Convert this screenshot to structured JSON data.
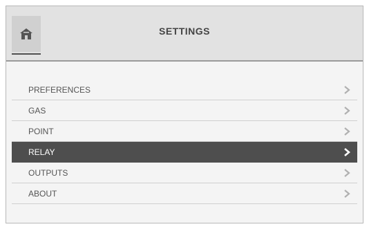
{
  "header": {
    "title": "SETTINGS",
    "home_icon": "home-icon"
  },
  "menu": {
    "items": [
      {
        "label": "PREFERENCES",
        "icon": "chevron-right-icon",
        "selected": false
      },
      {
        "label": "GAS",
        "icon": "chevron-right-icon",
        "selected": false
      },
      {
        "label": "POINT",
        "icon": "chevron-right-icon",
        "selected": false
      },
      {
        "label": "RELAY",
        "icon": "chevron-right-icon",
        "selected": true
      },
      {
        "label": "OUTPUTS",
        "icon": "chevron-right-icon",
        "selected": false
      },
      {
        "label": "ABOUT",
        "icon": "chevron-right-icon",
        "selected": false
      }
    ]
  },
  "colors": {
    "header_bg": "#e2e2e2",
    "screen_bg": "#f4f4f4",
    "selected_bg": "#4e4e4e",
    "selected_text": "#ffffff",
    "item_text": "#555555",
    "chevron": "#b0b0b0"
  }
}
